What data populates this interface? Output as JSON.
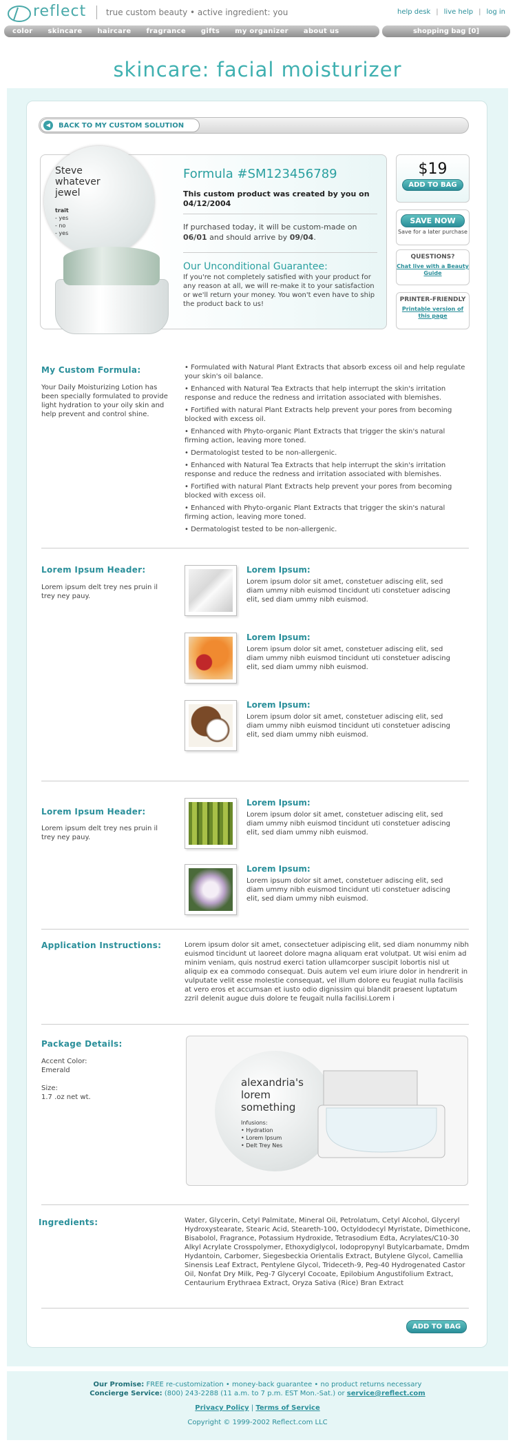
{
  "header": {
    "logo": "reflect",
    "tagline": "true custom beauty • active ingredient: you",
    "links": [
      "help desk",
      "live help",
      "log in"
    ],
    "nav": [
      "color",
      "skincare",
      "haircare",
      "fragrance",
      "gifts",
      "my organizer",
      "about us"
    ],
    "bag": "shopping bag [0]"
  },
  "page": {
    "title": "skincare: facial moisturizer",
    "back": "BACK TO MY CUSTOM SOLUTION"
  },
  "product": {
    "name": "Steve whatever jewel",
    "trait_label": "trait",
    "traits": [
      "- yes",
      "- no",
      "- yes"
    ],
    "formula": "Formula #SM123456789",
    "custom_note": "This custom product was created by you on 04/12/2004",
    "made_prefix": "If purchased today, it will be custom-made on",
    "made_date": "06/01",
    "made_mid": "and should arrive by",
    "arrive_date": "09/04",
    "guarantee_title": "Our Unconditional Guarantee:",
    "guarantee_text": "If you're not completely satisfied with your product for any reason at all, we will re-make it to your satisfaction or we'll return your money. You won't even have to ship the product back to us!"
  },
  "side": {
    "price": "$19",
    "add_to_bag": "ADD TO BAG",
    "save_now": "SAVE NOW",
    "save_note": "Save for a later purchase",
    "questions": "QUESTIONS?",
    "questions_link": "Chat live with a Beauty Guide",
    "printer": "PRINTER-FRIENDLY",
    "printer_link": "Printable version of this page"
  },
  "formula_section": {
    "header": "My Custom Formula:",
    "desc": "Your Daily Moisturizing Lotion has been specially formulated to provide light hydration to your oily skin and help prevent and control shine.",
    "bullets": [
      "• Formulated with Natural Plant Extracts that absorb excess oil and help regulate your skin's oil balance.",
      "• Enhanced with Natural Tea Extracts that help interrupt the skin's irritation response and reduce the redness and irritation associated with blemishes.",
      "• Fortified with natural Plant Extracts help prevent your pores from becoming blocked with excess oil.",
      "• Enhanced with Phyto-organic Plant Extracts that trigger the skin's natural firming action, leaving more toned.",
      "• Dermatologist tested to be non-allergenic.",
      "• Enhanced with Natural Tea Extracts that help interrupt the skin's irritation response and reduce the redness and irritation associated with blemishes.",
      "• Fortified with natural Plant Extracts help prevent your pores from becoming blocked with excess oil.",
      "• Enhanced with Phyto-organic Plant Extracts that trigger the skin's natural firming action, leaving more toned.",
      "• Dermatologist tested to be non-allergenic."
    ]
  },
  "lorem1": {
    "header": "Lorem Ipsum Header:",
    "desc": "Lorem ipsum delt trey nes pruin il trey ney pauy.",
    "items": [
      {
        "title": "Lorem Ipsum:",
        "text": "Lorem ipsum dolor sit amet, constetuer adiscing elit, sed diam ummy nibh euismod tincidunt uti constetuer adiscing elit, sed diam ummy nibh euismod.",
        "icon": "window-light-photo"
      },
      {
        "title": "Lorem Ipsum:",
        "text": "Lorem ipsum dolor sit amet, constetuer adiscing elit, sed diam ummy nibh euismod tincidunt uti constetuer adiscing elit, sed diam ummy nibh euismod.",
        "icon": "fruit-photo"
      },
      {
        "title": "Lorem Ipsum:",
        "text": "Lorem ipsum dolor sit amet, constetuer adiscing elit, sed diam ummy nibh euismod tincidunt uti constetuer adiscing elit, sed diam ummy nibh euismod.",
        "icon": "coconut-photo"
      }
    ]
  },
  "lorem2": {
    "header": "Lorem Ipsum Header:",
    "desc": "Lorem ipsum delt trey nes pruin il trey ney pauy.",
    "items": [
      {
        "title": "Lorem Ipsum:",
        "text": "Lorem ipsum dolor sit amet, constetuer adiscing elit, sed diam ummy nibh euismod tincidunt uti constetuer adiscing elit, sed diam ummy nibh euismod.",
        "icon": "bamboo-photo"
      },
      {
        "title": "Lorem Ipsum:",
        "text": "Lorem ipsum dolor sit amet, constetuer adiscing elit, sed diam ummy nibh euismod tincidunt uti constetuer adiscing elit, sed diam ummy nibh euismod.",
        "icon": "flower-photo"
      }
    ]
  },
  "application": {
    "header": "Application Instructions:",
    "text": "Lorem ipsum dolor sit amet, consectetuer adipiscing elit, sed diam nonummy nibh euismod tincidunt ut laoreet dolore magna aliquam erat volutpat. Ut wisi enim ad minim veniam, quis nostrud exerci tation ullamcorper suscipit lobortis nisl ut aliquip ex ea commodo consequat. Duis autem vel eum iriure dolor in hendrerit in vulputate velit esse molestie consequat, vel illum dolore eu feugiat nulla facilisis at vero eros et accumsan et iusto odio dignissim qui blandit praesent luptatum zzril delenit augue duis dolore te feugait nulla facilisi.Lorem i"
  },
  "package": {
    "header": "Package Details:",
    "accent_label": "Accent Color:",
    "accent_value": "Emerald",
    "size_label": "Size:",
    "size_value": "1.7 .oz net wt.",
    "brand": "alexandria's lorem something",
    "infusions_label": "Infusions:",
    "infusions": [
      "• Hydration",
      "• Lorem Ipsum",
      "• Delt Trey Nes"
    ]
  },
  "ingredients": {
    "header": "Ingredients:",
    "text": "Water, Glycerin, Cetyl Palmitate, Mineral Oil, Petrolatum, Cetyl Alcohol, Glyceryl Hydroxystearate, Stearic Acid, Steareth-100, Octyldodecyl Myristate, Dimethicone, Bisabolol, Fragrance, Potassium Hydroxide, Tetrasodium Edta, Acrylates/C10-30 Alkyl Acrylate Crosspolymer, Ethoxydiglycol, Iodopropynyl Butylcarbamate, Dmdm Hydantoin, Carbomer, Siegesbeckia Orientalis Extract, Butylene Glycol, Camellia Sinensis Leaf Extract, Pentylene Glycol, Trideceth-9, Peg-40 Hydrogenated Castor Oil, Nonfat Dry Milk, Peg-7 Glyceryl Cocoate, Epilobium Angustifolium Extract, Centaurium Erythraea Extract, Oryza Sativa (Rice) Bran Extract"
  },
  "footer": {
    "promise_label": "Our Promise:",
    "promise": "FREE re-customization • money-back guarantee • no product returns necessary",
    "concierge_label": "Concierge Service:",
    "concierge": "(800) 243-2288 (11 a.m. to 7 p.m. EST Mon.-Sat.) or",
    "email": "service@reflect.com",
    "privacy": "Privacy Policy",
    "terms": "Terms of Service",
    "copyright": "Copyright © 1999-2002 Reflect.com LLC"
  },
  "colors": {
    "accent": "#2aa0a0",
    "button": "#2a8f9a",
    "background_tint": "#e6f6f6"
  }
}
